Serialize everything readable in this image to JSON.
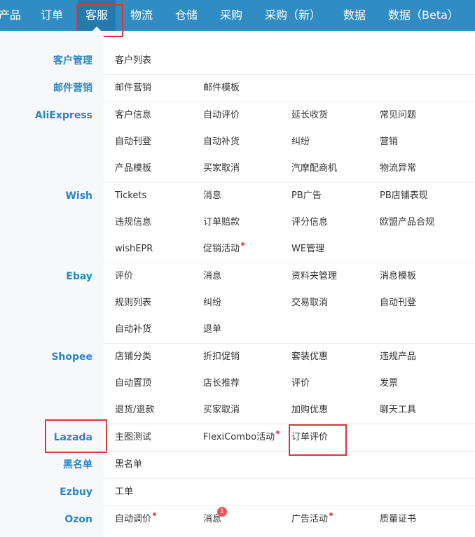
{
  "nav": {
    "items": [
      "产品",
      "订单",
      "客服",
      "物流",
      "仓储",
      "采购",
      "采购（新）",
      "数据",
      "数据（Beta）"
    ],
    "active": "客服"
  },
  "groups": [
    {
      "name": "客户管理",
      "items": [
        "客户列表"
      ]
    },
    {
      "name": "邮件营销",
      "items": [
        "邮件营销",
        "邮件模板"
      ]
    },
    {
      "name": "AliExpress",
      "items": [
        "客户信息",
        "自动评价",
        "延长收货",
        "常见问题",
        "自动刊登",
        "自动补货",
        "纠纷",
        "营销",
        "产品模板",
        "买家取消",
        "汽摩配商机",
        "物流异常"
      ]
    },
    {
      "name": "Wish",
      "items": [
        "Tickets",
        "消息",
        "PB广告",
        "PB店铺表现",
        "违规信息",
        "订单赔款",
        "评分信息",
        "欧盟产品合规",
        "wishEPR",
        "促销活动",
        "WE管理"
      ]
    },
    {
      "name": "Ebay",
      "items": [
        "评价",
        "消息",
        "资料夹管理",
        "消息模板",
        "规则列表",
        "纠纷",
        "交易取消",
        "自动刊登",
        "自动补货",
        "退单"
      ]
    },
    {
      "name": "Shopee",
      "items": [
        "店铺分类",
        "折扣促销",
        "套装优惠",
        "违规产品",
        "自动置顶",
        "店长推荐",
        "评价",
        "发票",
        "退货/退款",
        "买家取消",
        "加购优惠",
        "聊天工具"
      ]
    },
    {
      "name": "Lazada",
      "items": [
        "主图测试",
        "FlexiCombo活动",
        "订单评价"
      ]
    },
    {
      "name": "黑名单",
      "items": [
        "黑名单"
      ]
    },
    {
      "name": "Ezbuy",
      "items": [
        "工单"
      ]
    },
    {
      "name": "Ozon",
      "items": [
        "自动调价",
        "消息",
        "广告活动",
        "质量证书"
      ]
    }
  ],
  "badges": {
    "ozon_message_count": "1"
  },
  "colors": {
    "nav_bg": "#2f8dc4",
    "category_text": "#2b87c5",
    "highlight_box": "#d9363e",
    "notice_dot": "#f0525a"
  }
}
